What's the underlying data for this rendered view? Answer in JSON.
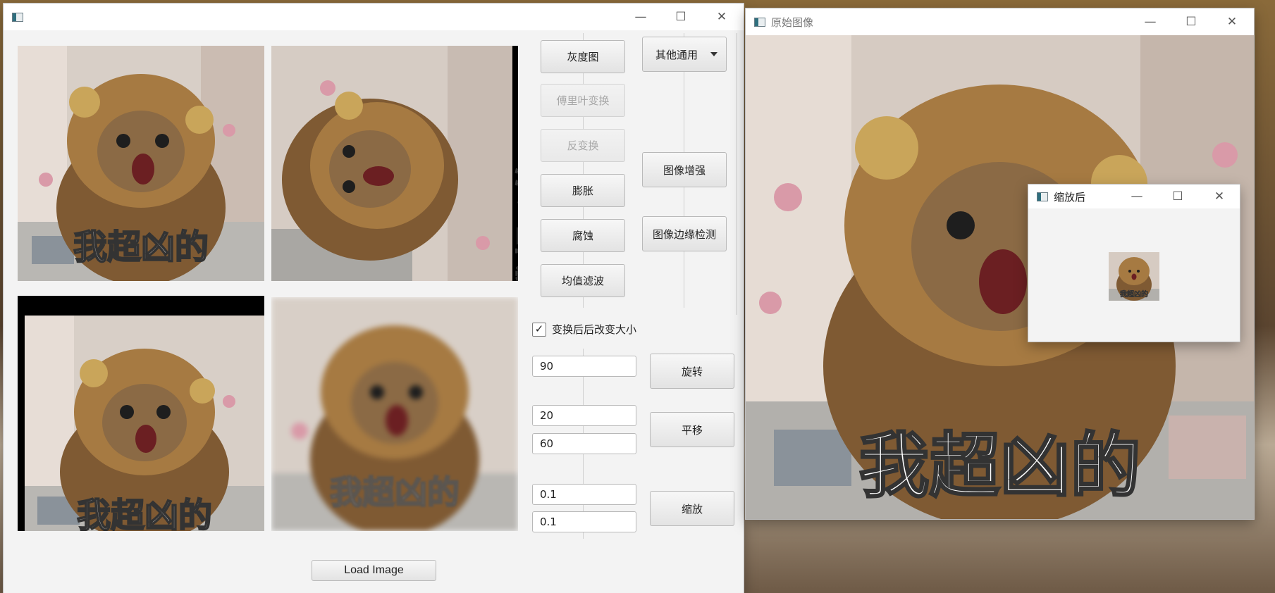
{
  "main_window": {
    "title": "",
    "images": [
      {
        "name": "gray-preview",
        "caption": "我超凶的"
      },
      {
        "name": "rotated-preview",
        "caption": "我超凶的"
      },
      {
        "name": "shifted-preview",
        "caption": "我超凶的"
      },
      {
        "name": "blurred-preview",
        "caption": "我超凶的"
      }
    ],
    "buttons": {
      "grayscale": "灰度图",
      "fourier": "傅里叶变换",
      "inverse": "反变换",
      "dilate": "膨胀",
      "erode": "腐蚀",
      "mean_filter": "均值滤波",
      "other_common": "其他通用",
      "enhance": "图像增强",
      "edge_detect": "图像边缘检测",
      "rotate": "旋转",
      "translate": "平移",
      "scale": "缩放",
      "load": "Load Image"
    },
    "checkbox_label": "变换后后改变大小",
    "checkbox_checked": true,
    "inputs": {
      "rotate_angle": "90",
      "translate_x": "20",
      "translate_y": "60",
      "scale_x": "0.1",
      "scale_y": "0.1"
    }
  },
  "original_window": {
    "title": "原始图像",
    "caption": "我超凶的"
  },
  "scaled_window": {
    "title": "缩放后",
    "caption": "我超凶的"
  },
  "window_controls": {
    "minimize": "—",
    "maximize": "☐",
    "close": "✕"
  },
  "colors": {
    "fur": "#8a6233",
    "fur_dark": "#5b3d1c",
    "mane": "#b58a4b",
    "sofa": "#d9c9c0",
    "pink_flower": "#d99aa8"
  }
}
